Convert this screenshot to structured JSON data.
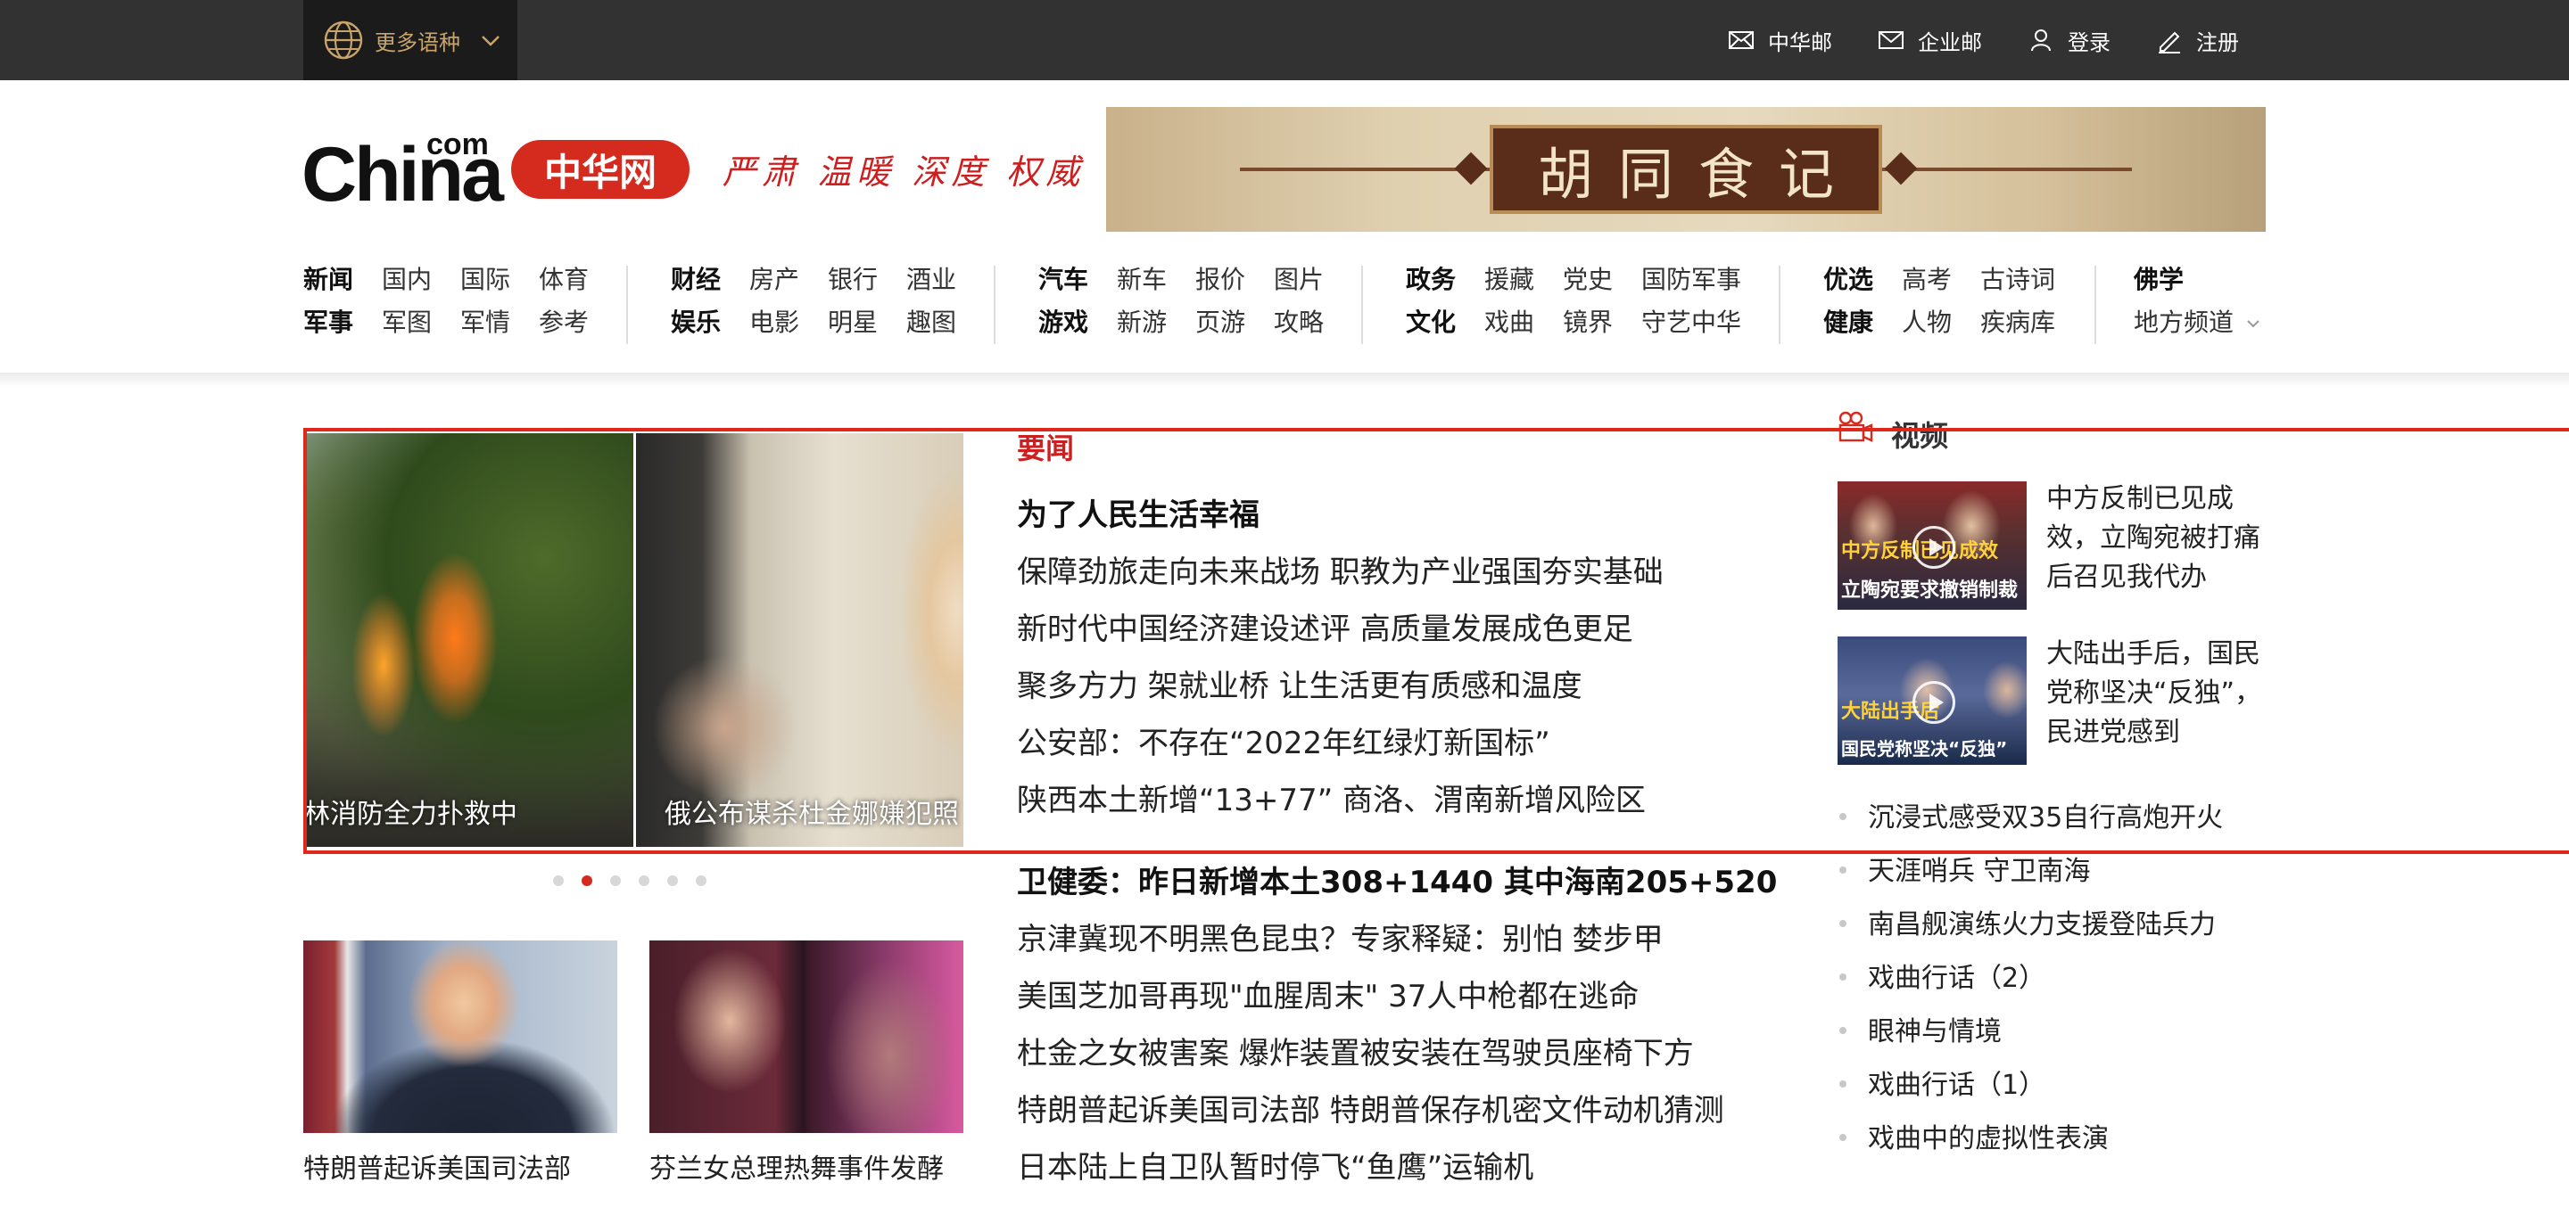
{
  "topbar": {
    "language_label": "更多语种",
    "links": [
      {
        "label": "中华邮",
        "icon": "mail-icon"
      },
      {
        "label": "企业邮",
        "icon": "envelope-icon"
      },
      {
        "label": "登录",
        "icon": "user-icon"
      },
      {
        "label": "注册",
        "icon": "edit-icon"
      }
    ]
  },
  "header": {
    "logo_text": "China",
    "logo_sup": "com",
    "logo_badge": "中华网",
    "slogan": "严肃 温暖 深度 权威",
    "banner_title": "胡同食记"
  },
  "nav": {
    "groups": [
      {
        "row1": [
          "新闻",
          "国内",
          "国际",
          "体育"
        ],
        "row2": [
          "军事",
          "军图",
          "军情",
          "参考"
        ]
      },
      {
        "row1": [
          "财经",
          "房产",
          "银行",
          "酒业"
        ],
        "row2": [
          "娱乐",
          "电影",
          "明星",
          "趣图"
        ]
      },
      {
        "row1": [
          "汽车",
          "新车",
          "报价",
          "图片"
        ],
        "row2": [
          "游戏",
          "新游",
          "页游",
          "攻略"
        ]
      },
      {
        "row1": [
          "政务",
          "援藏",
          "党史",
          "国防军事"
        ],
        "row2": [
          "文化",
          "戏曲",
          "镜界",
          "守艺中华"
        ]
      },
      {
        "row1": [
          "优选",
          "高考",
          "古诗词"
        ],
        "row2": [
          "健康",
          "人物",
          "疾病库"
        ]
      },
      {
        "row1": [
          "佛学"
        ],
        "row2": [
          "地方频道"
        ]
      }
    ]
  },
  "slider": {
    "slides": [
      {
        "caption": "森林消防全力扑救中"
      },
      {
        "caption": "俄公布谋杀杜金娜嫌犯照"
      }
    ],
    "dot_count": 6,
    "active_dot": 1
  },
  "tiles": [
    {
      "caption": "特朗普起诉美国司法部"
    },
    {
      "caption": "芬兰女总理热舞事件发酵"
    }
  ],
  "news": {
    "heading": "要闻",
    "items": [
      {
        "text": "为了人民生活幸福",
        "bold": true
      },
      {
        "text": "保障劲旅走向未来战场 职教为产业强国夯实基础",
        "bold": false
      },
      {
        "text": "新时代中国经济建设述评 高质量发展成色更足",
        "bold": false
      },
      {
        "text": "聚多方力 架就业桥 让生活更有质感和温度",
        "bold": false
      },
      {
        "text": "公安部：不存在“2022年红绿灯新国标”",
        "bold": false
      },
      {
        "text": "陕西本土新增“13+77” 商洛、渭南新增风险区",
        "bold": false
      },
      {
        "text": "卫健委：昨日新增本土308+1440 其中海南205+520",
        "bold": true
      },
      {
        "text": "京津冀现不明黑色昆虫？专家释疑：别怕 婪步甲",
        "bold": false
      },
      {
        "text": "美国芝加哥再现\"血腥周末\" 37人中枪都在逃命",
        "bold": false
      },
      {
        "text": "杜金之女被害案 爆炸装置被安装在驾驶员座椅下方",
        "bold": false
      },
      {
        "text": "特朗普起诉美国司法部 特朗普保存机密文件动机猜测",
        "bold": false
      },
      {
        "text": "日本陆上自卫队暂时停飞“鱼鹰”运输机",
        "bold": false
      }
    ]
  },
  "video": {
    "heading": "视频",
    "cards": [
      {
        "title": "中方反制已见成效，立陶宛被打痛后召见我代办",
        "thumb_line1": "中方反制已见成效",
        "thumb_line2": "立陶宛要求撤销制裁"
      },
      {
        "title": "大陆出手后，国民党称坚决“反独”，民进党感到",
        "thumb_line1": "大陆出手后",
        "thumb_line2": "国民党称坚决“反独”"
      }
    ],
    "list": [
      "沉浸式感受双35自行高炮开火",
      "天涯哨兵 守卫南海",
      "南昌舰演练火力支援登陆兵力",
      "戏曲行话（2）",
      "眼神与情境",
      "戏曲行话（1）",
      "戏曲中的虚拟性表演"
    ]
  },
  "colors": {
    "topbar_bg": "#323232",
    "accent_red": "#cc1f1f",
    "highlight_red": "#e0271c",
    "gold": "#c9a46a"
  }
}
